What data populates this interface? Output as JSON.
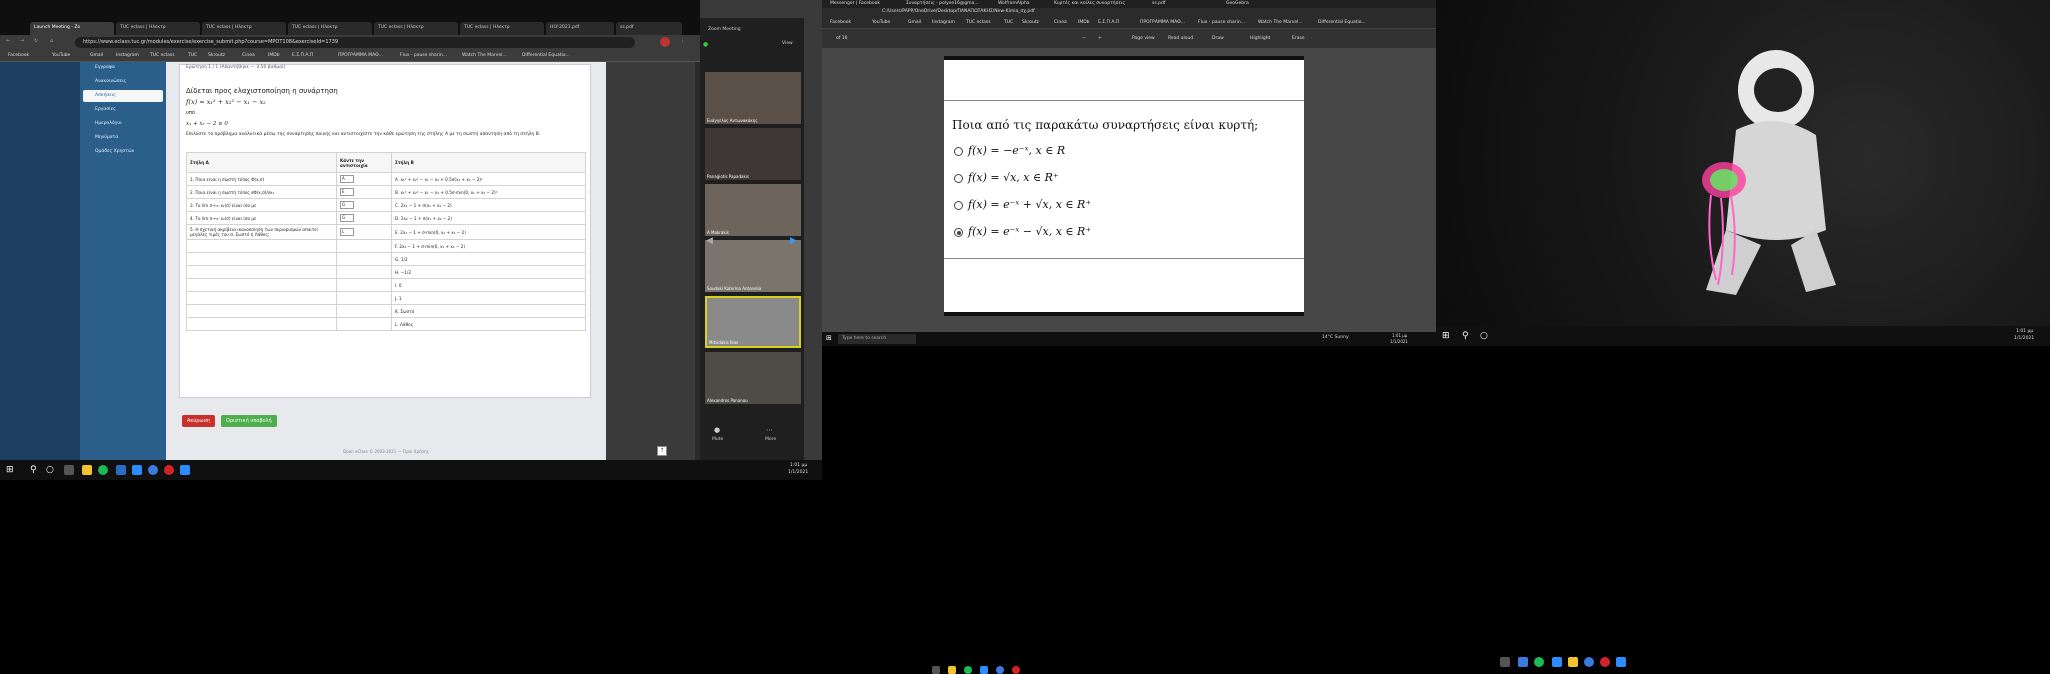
{
  "monitor1": {
    "tabs": [
      "Launch Meeting - Zo",
      "TUC eclass | Ηλεκτρ",
      "TUC eclass | Ηλεκτρ",
      "TUC eclass | Ηλεκτρ",
      "TUC eclass | Ηλεκτρ",
      "TUC eclass | Ηλεκτρ",
      "HLY-2021.pdf",
      "ss.pdf"
    ],
    "url": "https://www.eclass.tuc.gr/modules/exercise/exercise_submit.php?course=MPOT108&exerciseId=1739",
    "bookmarks": [
      "Facebook",
      "YouTube",
      "Gmail",
      "Instagram",
      "TUC eclass",
      "TUC",
      "Skroutz",
      "Cinea",
      "IMDb",
      "E.Σ.Π.Α.Π",
      "ΠΡΟΓΡΑΜΜΑ ΜΑΘ...",
      "Flux - pause sharin...",
      "Watch The Marvel...",
      "Differential Equatio..."
    ],
    "sidebar": [
      {
        "label": "Εγγραφα"
      },
      {
        "label": "Ανακοινώσεις"
      },
      {
        "label": "Ασκήσεις"
      },
      {
        "label": "Εργασίες"
      },
      {
        "label": "Ημερολόγιο"
      },
      {
        "label": "Μηνύματα"
      },
      {
        "label": "Ομάδες Χρηστών"
      }
    ],
    "quiz": {
      "header": "Ερώτηση 1 / 1 (Απαντήθηκε — 3.50 βαθμοί)",
      "prompt": "Δίδεται προς ελαχιστοποίηση η συνάρτηση",
      "func": "f(x) = x₁² + x₂² − x₁ − x₂",
      "subject_to": "υπό",
      "constraint": "x₁ + x₂ − 2 ≥ 0",
      "instructions": "Επιλύστε το πρόβλημα αναλυτικά μέσω της συνάρτησης ποινής και αντιστοιχίστε την κάθε ερώτηση της στήλης Α με τη σωστή απάντηση από τη στήλη Β.",
      "col_a": "Στήλη Α",
      "col_sel": "Κάντε την αντιστοιχία",
      "col_b": "Στήλη Β",
      "rows": [
        {
          "a": "1. Ποια είναι η σωστή τύπος Φ(x,σ)",
          "sel": "A",
          "b": "A. x₁² + x₂² − x₁ − x₂ + 0.5σ(x₁ + x₂ − 2)²"
        },
        {
          "a": "2. Ποια είναι η σωστή τύπος ∂Φ(x,σ)/∂x₁",
          "sel": "E",
          "b": "B. x₁² + x₂² − x₁ − x₂ + 0.5σ·min(0, x₁ + x₂ − 2)²"
        },
        {
          "a": "3. Το lim σ→∞ x₁(σ) είναι ίσο με",
          "sel": "G",
          "b": "C. 2x₁ − 1 + σ(x₁ + x₂ − 2)"
        },
        {
          "a": "4. Το lim σ→∞ x₂(σ) είναι ίσο με",
          "sel": "G",
          "b": "D. 2x₂ − 1 + σ(x₁ + x₂ − 2)"
        },
        {
          "a": "5. Η σχετική ακρίβεια ικανοποίηση των περιορισμών απαιτεί μεγάλες τιμές του σ. Σωστό ή Λάθος;",
          "sel": "L",
          "b": "E. 2x₁ − 1 + σ·min(0, x₁ + x₂ − 2)"
        },
        {
          "a": "",
          "sel": "",
          "b": "F. 2x₂ − 1 + σ·min(0, x₁ + x₂ − 2)"
        },
        {
          "a": "",
          "sel": "",
          "b": "G. 1/2"
        },
        {
          "a": "",
          "sel": "",
          "b": "H. −1/2"
        },
        {
          "a": "",
          "sel": "",
          "b": "I. 0"
        },
        {
          "a": "",
          "sel": "",
          "b": "J. 1"
        },
        {
          "a": "",
          "sel": "",
          "b": "K. Σωστό"
        },
        {
          "a": "",
          "sel": "",
          "b": "L. Λάθος"
        }
      ],
      "cancel": "Ακύρωση",
      "submit": "Οριστική υποβολή"
    },
    "footer": "Open eClass © 2003-2021 — Όροι Χρήσης",
    "meet": {
      "title": "Zoom Meeting",
      "view": "View",
      "participants": [
        "Ευάγγελος Αντωνακάκης",
        "Panagiotis Papadakis",
        "A Makrakis",
        "Soudaki Katerina Antonelia",
        "Mitsidakis Ilias",
        "Alexandros Pananou"
      ],
      "mute": "Mute",
      "more": "More"
    },
    "clock": {
      "time": "1:01 μμ",
      "date": "1/1/2021"
    }
  },
  "monitor2": {
    "tabs": [
      "Messenger | Facebook",
      "Συναρτήσεις - polyxe16@gma...",
      "WolframAlpha",
      "Κυρτές και κοίλες συναρτήσεις",
      "ss.pdf",
      "GeoGebra"
    ],
    "url": "C:/Users/PAPP/OneDrive/Desktop/ΠΑΝΑΓΙΩΤΑΚΗΣ/New-Kimia_σχ.pdf",
    "bookmarks": [
      "Facebook",
      "YouTube",
      "Gmail",
      "Instagram",
      "TUC eclass",
      "TUC",
      "Skroutz",
      "Cinea",
      "IMDb",
      "E.Σ.Π.Α.Π",
      "ΠΡΟΓΡΑΜΜΑ ΜΑΘ...",
      "Flux - pause sharin...",
      "Watch The Marvel...",
      "Differential Equatio..."
    ],
    "pdf_toolbar": {
      "page": "of 16",
      "page_view": "Page view",
      "read_aloud": "Read aloud",
      "draw": "Draw",
      "highlight": "Highlight",
      "erase": "Erase"
    },
    "question": "Ποια από τις παρακάτω συναρτήσεις είναι κυρτή;",
    "options": [
      {
        "text": "f(x) = −e⁻ˣ,    x ∈ R",
        "selected": false
      },
      {
        "text": "f(x) = √x,    x ∈ R⁺",
        "selected": false
      },
      {
        "text": "f(x) = e⁻ˣ + √x,    x ∈ R⁺",
        "selected": false
      },
      {
        "text": "f(x) = e⁻ˣ − √x,    x ∈ R⁺",
        "selected": true
      }
    ],
    "search_placeholder": "Type here to search",
    "weather": "14°C Sunny",
    "clock": {
      "time": "1:01 μμ",
      "date": "1/1/2021"
    }
  },
  "monitor3": {
    "clock": {
      "time": "1:01 μμ",
      "date": "1/1/2021"
    }
  },
  "colors": {
    "eclass_blue": "#2b5f8a",
    "cancel_red": "#c9302c",
    "submit_green": "#4cae4c",
    "accent": "#0078d4"
  }
}
